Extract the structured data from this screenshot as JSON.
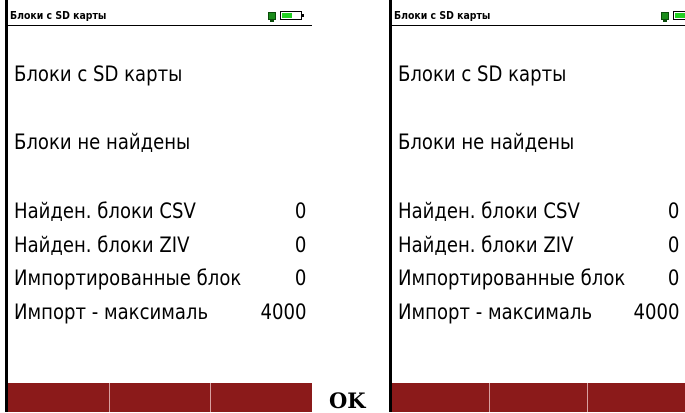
{
  "screens": [
    {
      "title": "Блоки  с SD карты",
      "heading": "Блоки  с SD карты",
      "status": "Блоки не найдены",
      "rows": [
        {
          "label": "Найден. блоки CSV",
          "value": "0"
        },
        {
          "label": "Найден. блоки ZIV",
          "value": "0"
        },
        {
          "label": "Импортированные блок",
          "value": "0"
        },
        {
          "label": "Импорт - максималь",
          "value": "4000"
        }
      ],
      "battery_level": 0.55
    },
    {
      "title": "Блоки  с SD карты",
      "heading": "Блоки  с SD карты",
      "status": "Блоки не найдены",
      "rows": [
        {
          "label": "Найден. блоки CSV",
          "value": "0"
        },
        {
          "label": "Найден. блоки ZIV",
          "value": "0"
        },
        {
          "label": "Импортированные блок",
          "value": "0"
        },
        {
          "label": "Импорт - максималь",
          "value": "4000"
        }
      ],
      "battery_level": 0.55
    }
  ],
  "softkey_color": "#8b1a1a",
  "battery_color": "#22d022",
  "transition_label": "OK"
}
